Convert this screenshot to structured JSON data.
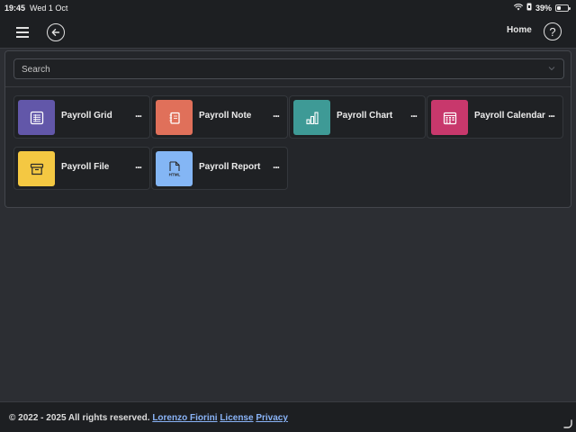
{
  "status_bar": {
    "time": "19:45",
    "date": "Wed 1 Oct",
    "battery_percent": "39%",
    "battery_level": 0.39,
    "icons": [
      "wifi-icon",
      "lock-rotation-icon",
      "battery-icon"
    ]
  },
  "nav": {
    "menu_icon": "hamburger-icon",
    "back_icon": "back-arrow-icon",
    "home_label": "Home",
    "help_label": "?"
  },
  "search": {
    "placeholder": "Search",
    "value": ""
  },
  "cards": [
    {
      "label": "Payroll Grid",
      "icon": "grid-icon",
      "color": "#6257a9"
    },
    {
      "label": "Payroll Note",
      "icon": "note-icon",
      "color": "#e0705a"
    },
    {
      "label": "Payroll Chart",
      "icon": "bar-chart-icon",
      "color": "#3e9a96"
    },
    {
      "label": "Payroll Calendar",
      "icon": "calendar-icon",
      "color": "#c8386c"
    },
    {
      "label": "Payroll File",
      "icon": "archive-box-icon",
      "color": "#f4c842"
    },
    {
      "label": "Payroll Report",
      "icon": "html-file-icon",
      "color": "#84b6f5"
    }
  ],
  "card_more_label": "...",
  "footer": {
    "copyright": "© 2022 - 2025 All rights reserved.",
    "author": "Lorenzo Fiorini",
    "license": "License",
    "privacy": "Privacy",
    "link_color": "#8ab4f8"
  }
}
